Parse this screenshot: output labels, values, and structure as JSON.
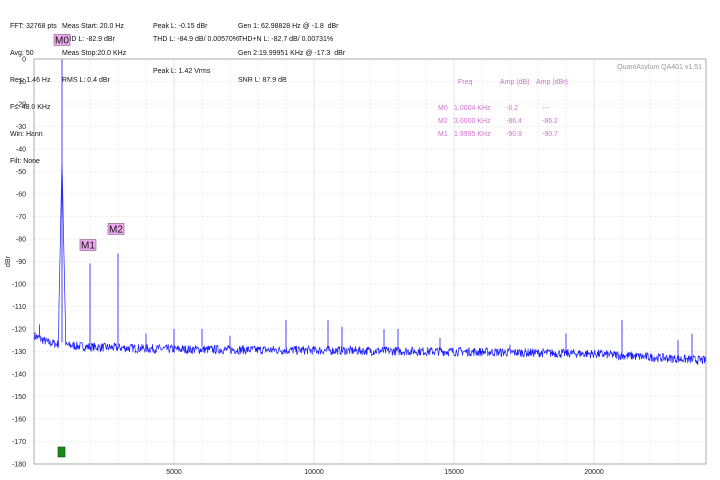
{
  "readouts": {
    "col1": [
      "FFT: 32768 pts",
      "Avg: 50",
      "Res: 1.46 Hz",
      "Fs: 48.0 KHz",
      "Win: Hann",
      "Filt: None"
    ],
    "col2": [
      "Meas Start: 20.0 Hz",
      "Meas Stop:20.0 KHz",
      "RMS L: 0.4 dBr"
    ],
    "thd_l": "THD L: -82.9 dBr",
    "col3": [
      "Peak L: -0.15 dBr",
      "",
      "Peak L: 1.42 Vrms"
    ],
    "thd_l_pct": "THD L: -84.9 dB/ 0.00570%",
    "col4": [
      "Gen 1: 62.98828 Hz @ -1.8  dBr",
      "Gen 2:19.99951 KHz @ -17.3  dBr",
      "SNR L: 87.9 dB"
    ],
    "thdn_l": "THD+N L: -82.7 dB/ 0.00731%"
  },
  "watermark": "QuantAsylum QA401 v1.51",
  "marker_table": {
    "headers": [
      "Freq",
      "Amp (dB)",
      "Amp (dBr)"
    ],
    "rows": [
      {
        "name": "M0",
        "freq": "1.0004 KHz",
        "amp_db": "-0.2",
        "amp_dbr": "---"
      },
      {
        "name": "M2",
        "freq": "3.0000 KHz",
        "amp_db": "-86.4",
        "amp_dbr": "-86.2"
      },
      {
        "name": "M1",
        "freq": "1.9995 KHz",
        "amp_db": "-90.9",
        "amp_dbr": "-90.7"
      }
    ]
  },
  "colors": {
    "trace": "#1a1aff",
    "grid": "#d8d8d8",
    "marker_fill": "#f0a8f0",
    "table_text": "#d070d0",
    "bottom_indicator": "#1a8a1a"
  },
  "chart_data": {
    "type": "line",
    "title": "",
    "xlabel": "",
    "ylabel": "dBr",
    "xlim": [
      0,
      24000
    ],
    "ylim": [
      -180,
      0
    ],
    "x_ticks": [
      5000,
      10000,
      15000,
      20000
    ],
    "y_ticks": [
      0,
      -10,
      -20,
      -30,
      -40,
      -50,
      -60,
      -70,
      -80,
      -90,
      -100,
      -110,
      -120,
      -130,
      -140,
      -150,
      -160,
      -170,
      -180
    ],
    "grid": true,
    "series": [
      {
        "noise_floor": [
          [
            20,
            -123
          ],
          [
            500,
            -126
          ],
          [
            1000,
            -127
          ],
          [
            2000,
            -128
          ],
          [
            5000,
            -129
          ],
          [
            10000,
            -129.5
          ],
          [
            15000,
            -130
          ],
          [
            20000,
            -131
          ],
          [
            24000,
            -134
          ]
        ],
        "peaks": [
          [
            200,
            -118
          ],
          [
            1000,
            -0.2
          ],
          [
            1999.5,
            -90.9
          ],
          [
            3000,
            -86.4
          ],
          [
            4000,
            -122
          ],
          [
            5000,
            -120
          ],
          [
            6000,
            -120
          ],
          [
            7000,
            -123
          ],
          [
            9000,
            -116
          ],
          [
            10500,
            -116
          ],
          [
            11000,
            -119
          ],
          [
            12500,
            -120
          ],
          [
            13000,
            -120
          ],
          [
            14500,
            -124
          ],
          [
            17000,
            -127
          ],
          [
            19000,
            -122
          ],
          [
            21000,
            -116
          ],
          [
            23000,
            -125
          ],
          [
            23500,
            -122
          ]
        ]
      }
    ],
    "markers": [
      {
        "name": "M0",
        "x": 1000,
        "y": -0.2
      },
      {
        "name": "M1",
        "x": 1999.5,
        "y": -90.9
      },
      {
        "name": "M2",
        "x": 3000,
        "y": -86.4
      }
    ]
  }
}
